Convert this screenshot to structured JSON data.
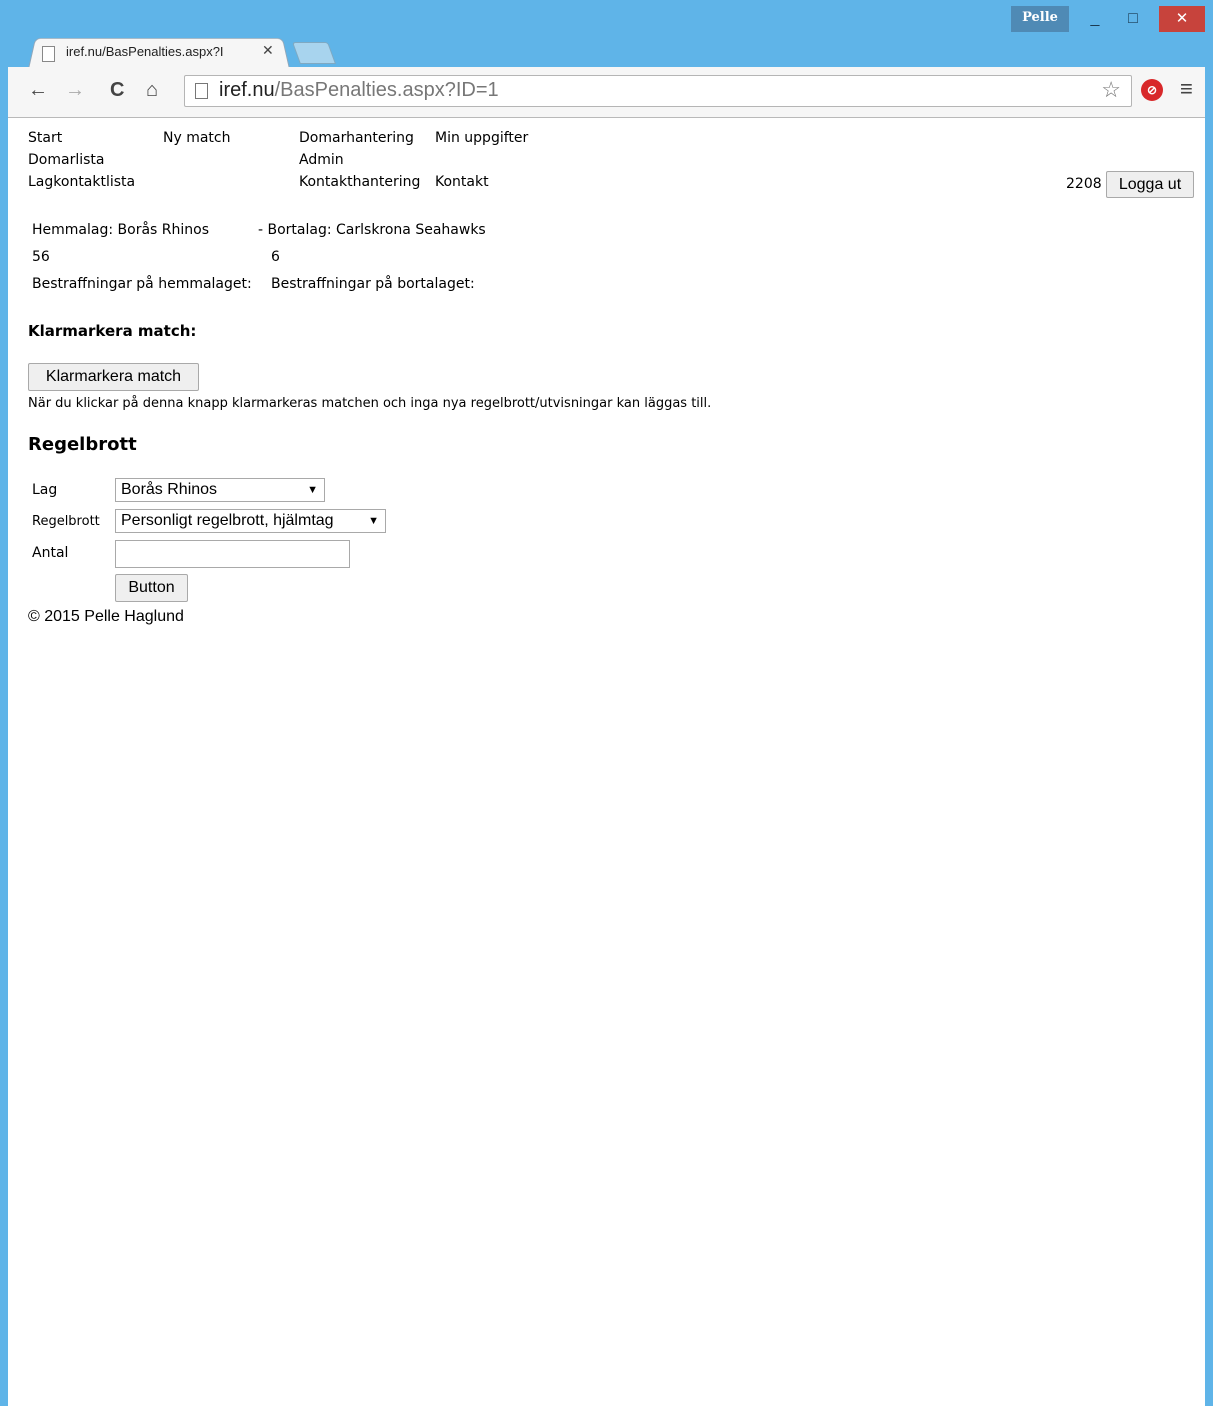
{
  "browser": {
    "profile_name": "Pelle",
    "tab_title": "iref.nu/BasPenalties.aspx?I",
    "url_domain": "iref.nu",
    "url_path": "/BasPenalties.aspx?ID=1",
    "window_controls": {
      "minimize": "_",
      "maximize": "□",
      "close": "✕"
    },
    "nav_icons": {
      "back": "←",
      "forward": "→",
      "reload": "C",
      "home": "⌂"
    }
  },
  "nav": {
    "col1": [
      "Start",
      "Domarlista",
      "Lagkontaktlista"
    ],
    "col2": [
      "Ny match"
    ],
    "col3": [
      "Domarhantering",
      "Admin",
      "Kontakthantering"
    ],
    "col4": [
      "Min uppgifter",
      "Kontakt"
    ],
    "user_id": "2208",
    "logout_label": "Logga ut"
  },
  "match": {
    "home_label": "Hemmalag: Borås Rhinos",
    "away_label": "- Bortalag: Carlskrona Seahawks",
    "home_score": "56",
    "away_score": "6",
    "home_penalties_label": "Bestraffningar på hemmalaget:",
    "away_penalties_label": "Bestraffningar på bortalaget:"
  },
  "finalize": {
    "heading": "Klarmarkera match:",
    "button_label": "Klarmarkera match",
    "info_text": "När du klickar på denna knapp klarmarkeras matchen och inga nya regelbrott/utvisningar kan läggas till."
  },
  "infraction": {
    "heading": "Regelbrott",
    "team_label": "Lag",
    "team_value": "Borås Rhinos",
    "rule_label": "Regelbrott",
    "rule_value": "Personligt regelbrott, hjälmtag",
    "count_label": "Antal",
    "count_value": "",
    "submit_label": "Button"
  },
  "footer": {
    "copyright": "© 2015 Pelle Haglund"
  }
}
